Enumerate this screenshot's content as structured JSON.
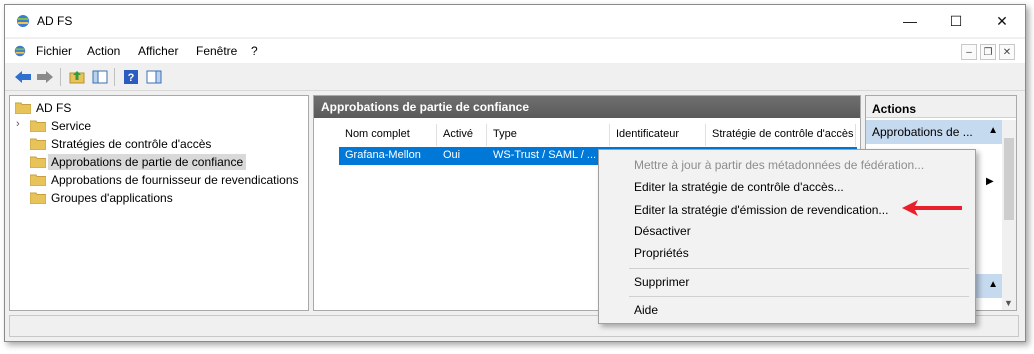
{
  "window": {
    "title": "AD FS",
    "controls": {
      "minimize": "—",
      "maximize": "☐",
      "close": "✕"
    }
  },
  "menubar": {
    "items": [
      "Fichier",
      "Action",
      "Afficher",
      "Fenêtre",
      "?"
    ],
    "mdi_minimize": "–",
    "mdi_restore": "❐",
    "mdi_close": "✕"
  },
  "toolbar": {
    "buttons": [
      "back-icon",
      "forward-icon",
      "up-folder-icon",
      "show-hide-tree-icon",
      "help-icon",
      "show-hide-action-pane-icon"
    ]
  },
  "tree": {
    "root": "AD FS",
    "items": [
      {
        "label": "Service",
        "expandable": true
      },
      {
        "label": "Stratégies de contrôle d'accès",
        "expandable": false
      },
      {
        "label": "Approbations de partie de confiance",
        "expandable": false,
        "selected": true
      },
      {
        "label": "Approbations de fournisseur de revendications",
        "expandable": false
      },
      {
        "label": "Groupes d'applications",
        "expandable": false
      }
    ],
    "expander_glyph": "›"
  },
  "center": {
    "title": "Approbations de partie de confiance",
    "columns": [
      "Nom complet",
      "Activé",
      "Type",
      "Identificateur",
      "Stratégie de contrôle d'accès"
    ],
    "rows": [
      {
        "name": "Grafana-Mellon",
        "enabled": "Oui",
        "type": "WS-Trust / SAML / ...",
        "identifier": "",
        "policy": ""
      }
    ]
  },
  "actions": {
    "title": "Actions",
    "section": "Approbations de ...",
    "section_toggle": "▲"
  },
  "context_menu": {
    "items": [
      {
        "label": "Mettre à jour à partir des métadonnées de fédération...",
        "disabled": true
      },
      {
        "label": "Editer la stratégie de contrôle d'accès...",
        "disabled": false
      },
      {
        "label": "Editer la stratégie d'émission de revendication...",
        "disabled": false
      },
      {
        "label": "Désactiver",
        "disabled": false
      },
      {
        "label": "Propriétés",
        "disabled": false
      },
      {
        "label": "Supprimer",
        "disabled": false
      },
      {
        "label": "Aide",
        "disabled": false
      }
    ]
  },
  "colors": {
    "selection": "#0078d7",
    "header_bg": "#646464",
    "actions_section": "#c5d9ef",
    "annotation_arrow": "#e8202a",
    "folder": "#e8c35a"
  }
}
